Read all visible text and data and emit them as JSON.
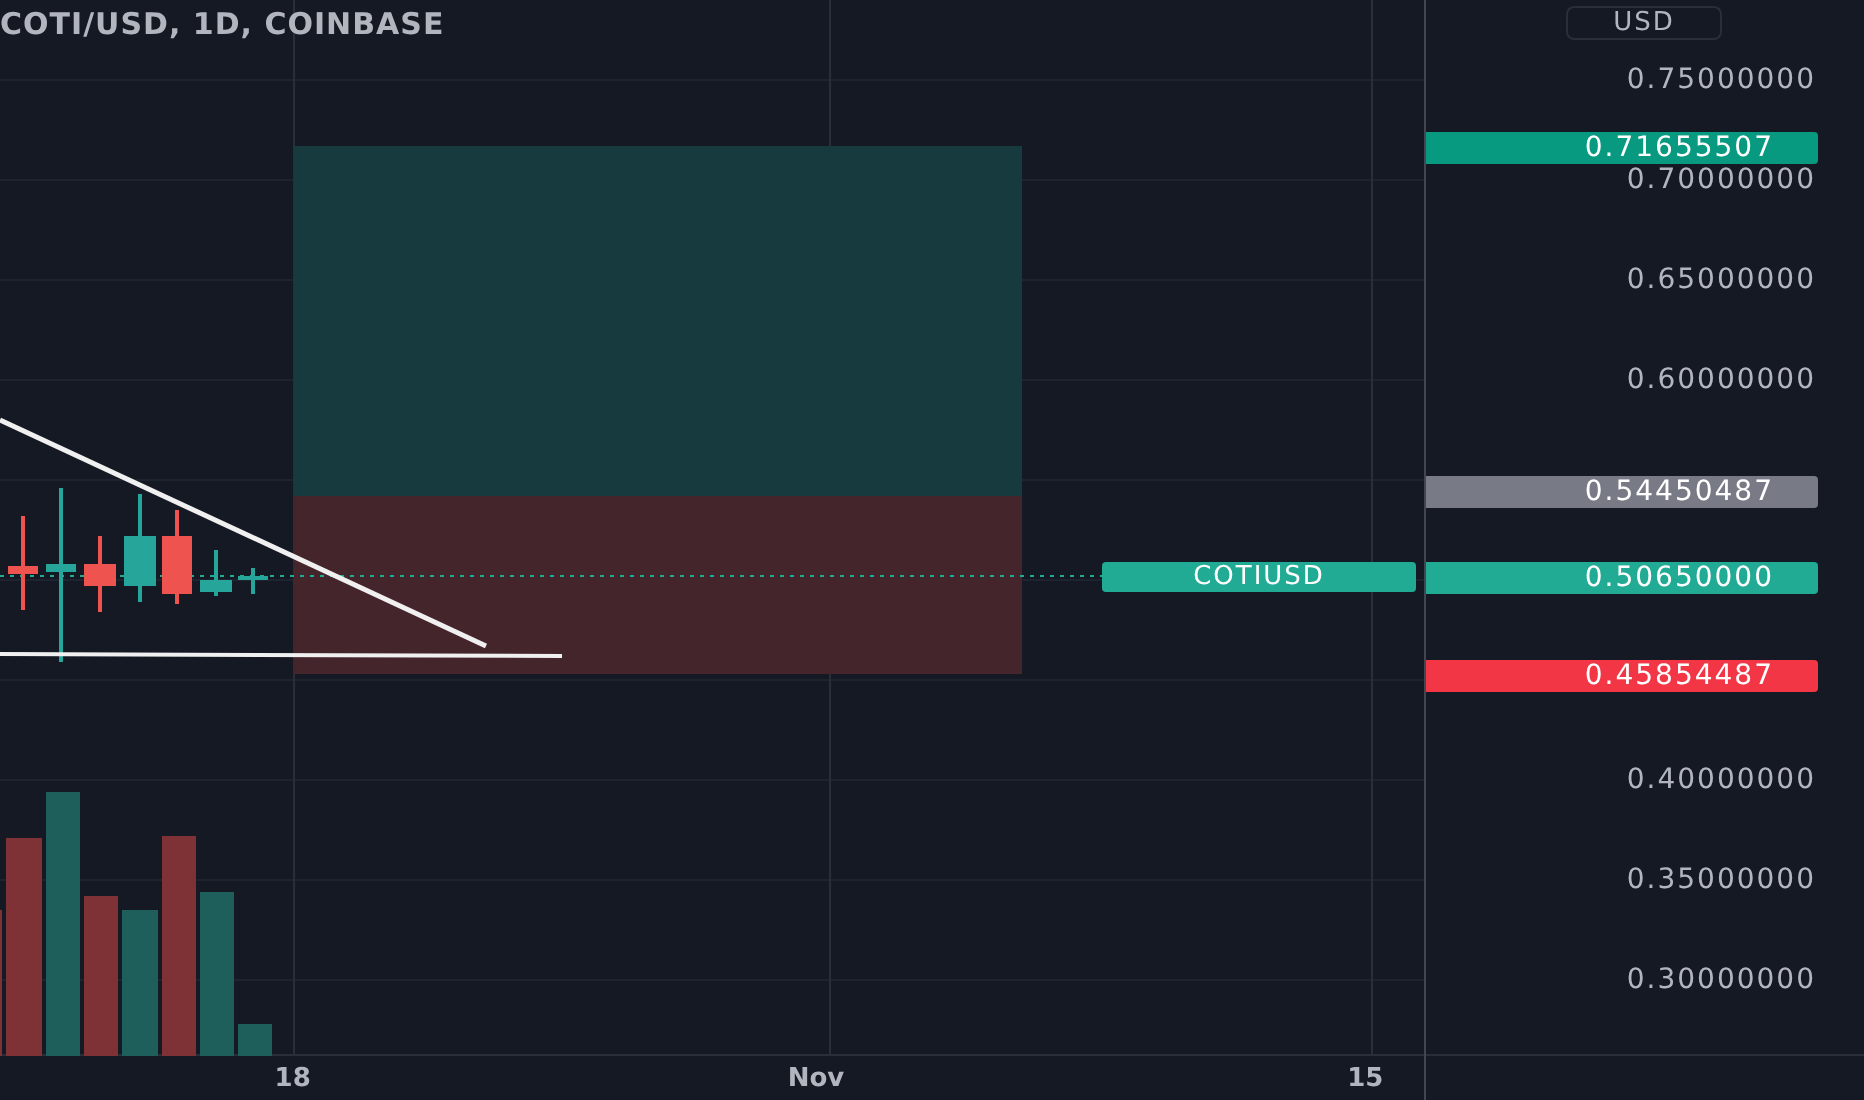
{
  "title": "COTI/USD, 1D, COINBASE",
  "currency_button": "USD",
  "price_axis": [
    "0.75000000",
    "0.70000000",
    "0.65000000",
    "0.60000000",
    "0.40000000",
    "0.35000000",
    "0.30000000"
  ],
  "price_tags": [
    {
      "kind": "target",
      "text": "0.71655507",
      "color": "#089981"
    },
    {
      "kind": "entry",
      "text": "0.54450487",
      "color": "#787b86"
    },
    {
      "kind": "current",
      "text": "0.50650000",
      "color": "#22ab94"
    },
    {
      "kind": "stop",
      "text": "0.45854487",
      "color": "#f23645"
    }
  ],
  "symbol_tag": {
    "text": "COTIUSD",
    "color": "#22ab94"
  },
  "time_axis": [
    "18",
    "Nov",
    "15"
  ]
}
